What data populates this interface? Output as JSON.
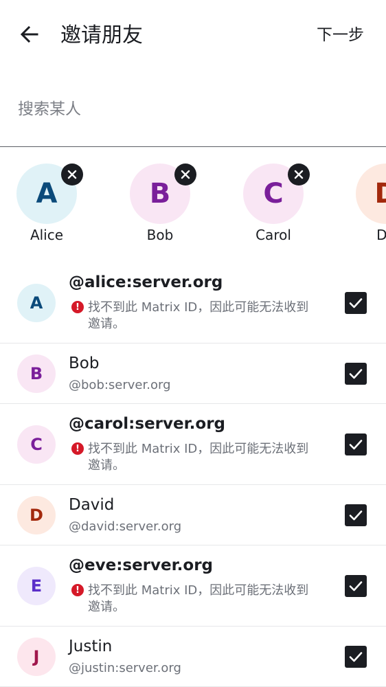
{
  "header": {
    "title": "邀请朋友",
    "next_label": "下一步"
  },
  "search": {
    "placeholder": "搜索某人"
  },
  "selected_chips": [
    {
      "initial": "A",
      "name": "Alice",
      "bg": "#e0f2f7",
      "fg": "#0b4a7a"
    },
    {
      "initial": "B",
      "name": "Bob",
      "bg": "#f9e6f4",
      "fg": "#7a1f9a"
    },
    {
      "initial": "C",
      "name": "Carol",
      "bg": "#f9e6f4",
      "fg": "#7a1f9a"
    },
    {
      "initial": "D",
      "name": "Da",
      "bg": "#fde9e0",
      "fg": "#a3290d"
    }
  ],
  "results": [
    {
      "initial": "A",
      "title": "@alice:server.org",
      "warning": "找不到此 Matrix ID，因此可能无法收到邀请。",
      "bg": "#e0f2f7",
      "fg": "#0b4a7a",
      "checked": true
    },
    {
      "initial": "B",
      "title": "Bob",
      "subtitle": "@bob:server.org",
      "bg": "#f9e6f4",
      "fg": "#7a1f9a",
      "checked": true
    },
    {
      "initial": "C",
      "title": "@carol:server.org",
      "warning": "找不到此 Matrix ID，因此可能无法收到邀请。",
      "bg": "#f9e6f4",
      "fg": "#7a1f9a",
      "checked": true
    },
    {
      "initial": "D",
      "title": "David",
      "subtitle": "@david:server.org",
      "bg": "#fde9e0",
      "fg": "#a3290d",
      "checked": true
    },
    {
      "initial": "E",
      "title": "@eve:server.org",
      "warning": "找不到此 Matrix ID，因此可能无法收到邀请。",
      "bg": "#efe9fc",
      "fg": "#5b2fc9",
      "checked": true
    },
    {
      "initial": "J",
      "title": "Justin",
      "subtitle": "@justin:server.org",
      "bg": "#fde6ed",
      "fg": "#a0174c",
      "checked": true
    }
  ],
  "icons": {
    "back": "arrow-left-icon",
    "remove": "close-icon",
    "warning": "error-icon",
    "check": "check-icon"
  },
  "colors": {
    "text": "#1b1d22",
    "secondary": "#6c7078",
    "error": "#d51928"
  }
}
